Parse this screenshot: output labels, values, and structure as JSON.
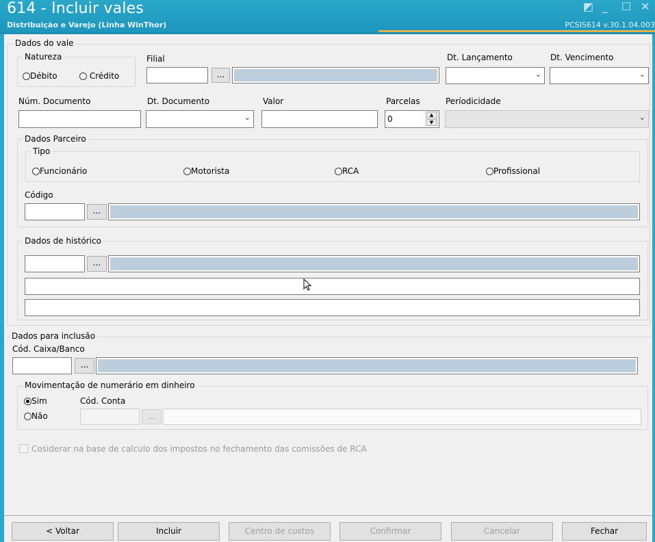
{
  "window": {
    "title": "614 - Incluir vales",
    "subtitle": "Distribuição e Varejo (Linha WinThor)",
    "version": "PCSIS614  v.30.1.04.003",
    "controls": {
      "minimize": "_",
      "maximize": "☐",
      "close": "✕",
      "edit": "◩"
    }
  },
  "vale": {
    "section": "Dados do vale",
    "natureza": {
      "legend": "Natureza",
      "debito": "Débito",
      "credito": "Crédito"
    },
    "filial": {
      "label": "Filial",
      "button": "..."
    },
    "dt_lancamento": {
      "label": "Dt. Lançamento"
    },
    "dt_vencimento": {
      "label": "Dt. Vencimento"
    },
    "num_documento": {
      "label": "Núm. Documento"
    },
    "dt_documento": {
      "label": "Dt. Documento"
    },
    "valor": {
      "label": "Valor"
    },
    "parcelas": {
      "label": "Parcelas",
      "value": "0"
    },
    "periodicidade": {
      "label": "Períodicidade"
    }
  },
  "parceiro": {
    "legend": "Dados Parceiro",
    "tipo": {
      "legend": "Tipo",
      "funcionario": "Funcionário",
      "motorista": "Motorista",
      "rca": "RCA",
      "profissional": "Profissional"
    },
    "codigo": {
      "label": "Código",
      "button": "..."
    }
  },
  "historico": {
    "legend": "Dados de histórico",
    "button": "..."
  },
  "inclusao": {
    "section": "Dados para inclusão",
    "caixa_banco": {
      "label": "Cód. Caixa/Banco",
      "button": "..."
    },
    "movimentacao": {
      "legend": "Movimentação de numerário em dinheiro",
      "sim": "Sim",
      "nao": "Não",
      "cod_conta": "Cód. Conta",
      "button": "..."
    }
  },
  "considerar": "Cosiderar na base de calculo dos impostos no fechamento das comissões de RCA",
  "buttons": {
    "voltar": "< Voltar",
    "incluir": "Incluir",
    "centro_custos": "Centro de custos",
    "confirmar": "Confirmar",
    "cancelar": "Cancelar",
    "fechar": "Fechar"
  }
}
